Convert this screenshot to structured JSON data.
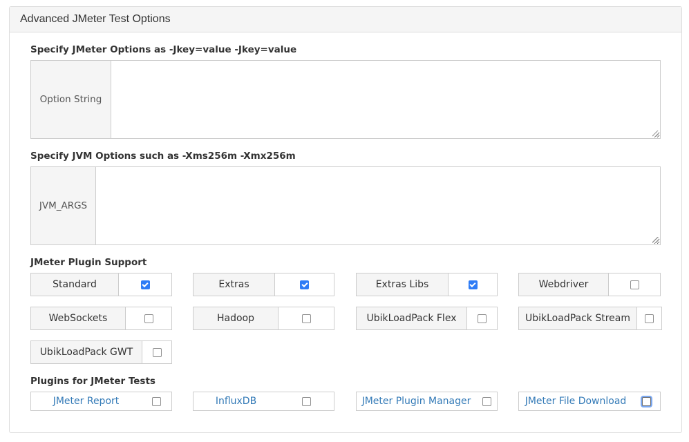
{
  "panel": {
    "title": "Advanced JMeter Test Options"
  },
  "jmeter_options": {
    "label": "Specify JMeter Options as -Jkey=value -Jkey=value",
    "addon": "Option String",
    "value": ""
  },
  "jvm_options": {
    "label": "Specify JVM Options such as -Xms256m -Xmx256m",
    "addon": "JVM_ARGS",
    "value": ""
  },
  "plugin_support": {
    "label": "JMeter Plugin Support",
    "items": [
      {
        "label": "Standard",
        "checked": true
      },
      {
        "label": "Extras",
        "checked": true
      },
      {
        "label": "Extras Libs",
        "checked": true
      },
      {
        "label": "Webdriver",
        "checked": false
      },
      {
        "label": "WebSockets",
        "checked": false
      },
      {
        "label": "Hadoop",
        "checked": false
      },
      {
        "label": "UbikLoadPack Flex",
        "checked": false
      },
      {
        "label": "UbikLoadPack Stream",
        "checked": false
      },
      {
        "label": "UbikLoadPack GWT",
        "checked": false
      }
    ]
  },
  "test_plugins": {
    "label": "Plugins for JMeter Tests",
    "items": [
      {
        "label": "JMeter Report",
        "checked": false
      },
      {
        "label": "InfluxDB",
        "checked": false
      },
      {
        "label": "JMeter Plugin Manager",
        "checked": false
      },
      {
        "label": "JMeter File Download",
        "checked": false,
        "focused": true
      }
    ]
  },
  "colors": {
    "link": "#337ab7",
    "checkbox_checked": "#2e7cf6",
    "addon_bg": "#f5f5f5"
  }
}
